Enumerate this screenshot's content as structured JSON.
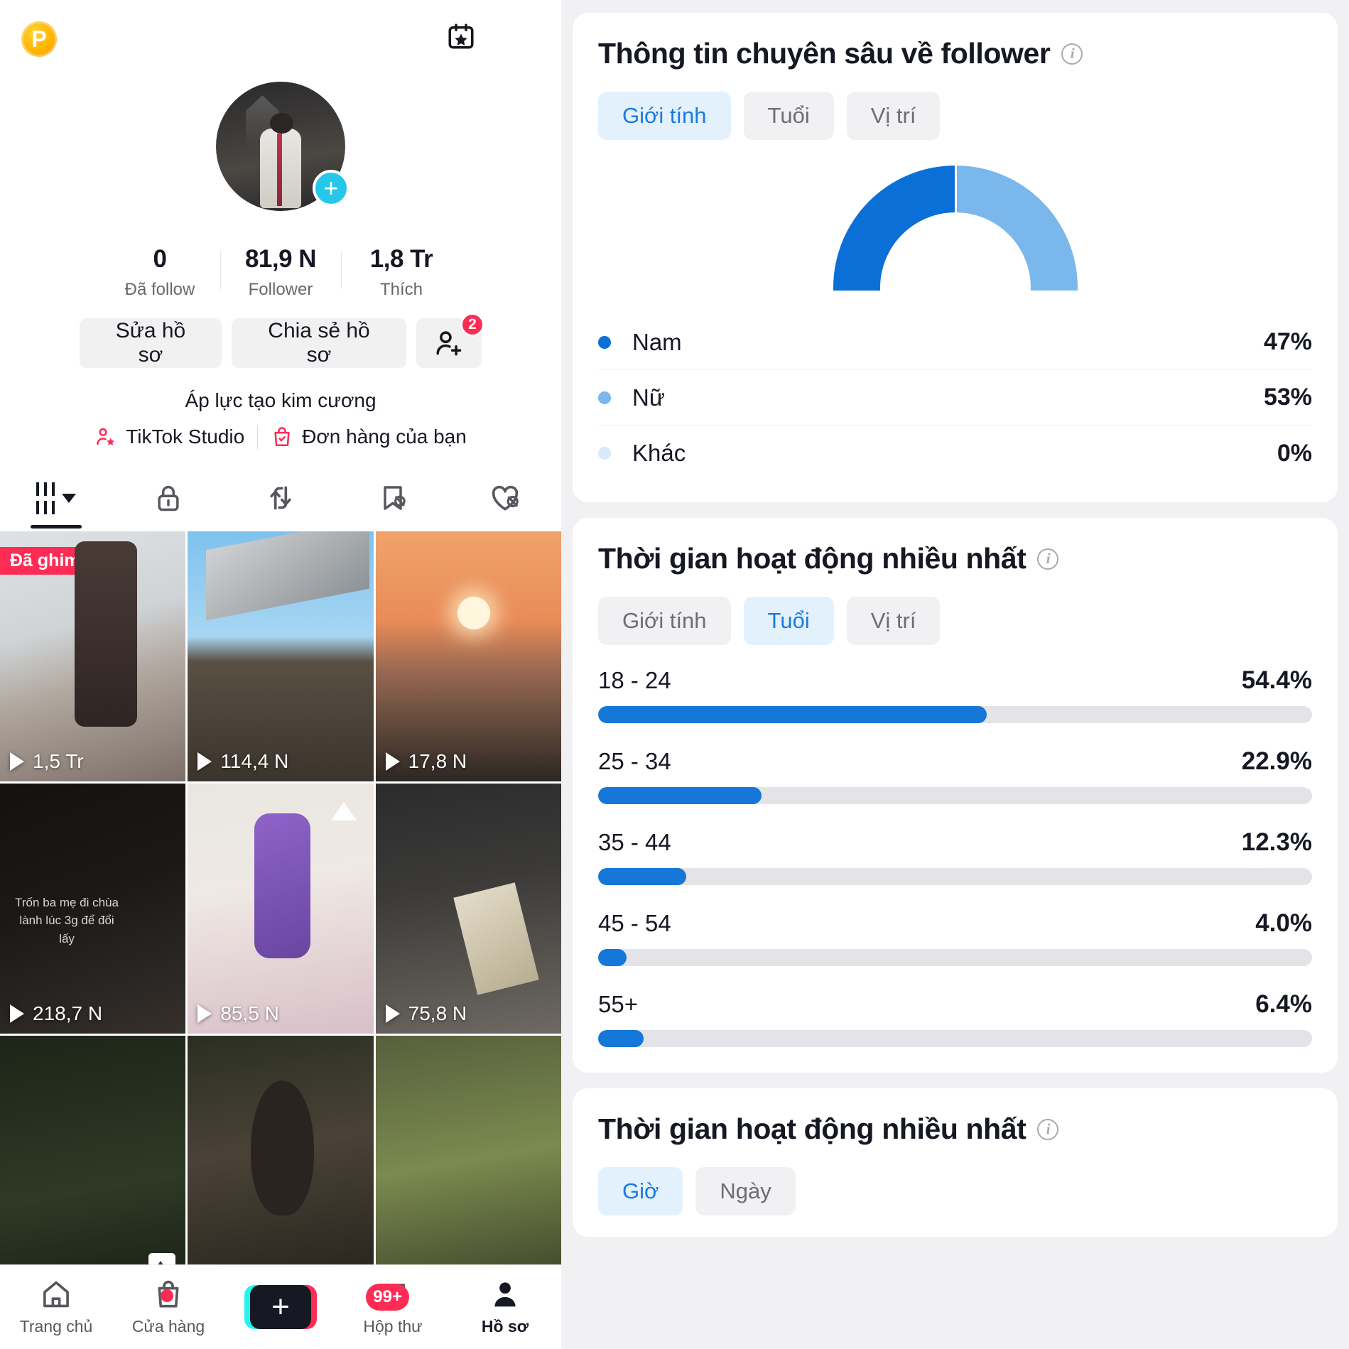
{
  "phone": {
    "topbar": {
      "coin_icon": "p-coin-icon",
      "coin_letter": "P",
      "calendar_icon": "calendar-star-icon",
      "menu_icon": "hamburger-menu-icon"
    },
    "profile": {
      "avatar_icon": "profile-avatar",
      "add_icon": "add-friend-plus-icon",
      "stats": [
        {
          "value": "0",
          "label": "Đã follow"
        },
        {
          "value": "81,9 N",
          "label": "Follower"
        },
        {
          "value": "1,8 Tr",
          "label": "Thích"
        }
      ],
      "edit_label": "Sửa hồ sơ",
      "share_label": "Chia sẻ hồ sơ",
      "add_friend_icon": "add-person-icon",
      "add_friend_badge": "2",
      "bio": "Áp lực tạo kim cương",
      "links": [
        {
          "label": "TikTok Studio",
          "icon": "studio-person-star-icon"
        },
        {
          "label": "Đơn hàng của bạn",
          "icon": "orders-bag-check-icon"
        }
      ]
    },
    "content_tabs": [
      {
        "name": "grid-posts-tab",
        "icon": "grid-bars-icon",
        "active": true
      },
      {
        "name": "private-tab",
        "icon": "lock-icon",
        "active": false
      },
      {
        "name": "repost-tab",
        "icon": "repost-arrows-icon",
        "active": false
      },
      {
        "name": "saved-tab",
        "icon": "bookmark-hidden-icon",
        "active": false
      },
      {
        "name": "liked-tab",
        "icon": "heart-hidden-icon",
        "active": false
      }
    ],
    "videos": [
      {
        "views": "1,5 Tr",
        "pinned_label": "Đã ghim"
      },
      {
        "views": "114,4 N",
        "pinned_label": ""
      },
      {
        "views": "17,8 N",
        "pinned_label": ""
      },
      {
        "views": "218,7 N",
        "pinned_label": "",
        "caption": "Trốn ba mẹ đi chùa lành lúc 3g để đổi lấy"
      },
      {
        "views": "85,5 N",
        "pinned_label": ""
      },
      {
        "views": "75,8 N",
        "pinned_label": ""
      },
      {
        "views": "",
        "pinned_label": ""
      },
      {
        "views": "",
        "pinned_label": ""
      },
      {
        "views": "",
        "pinned_label": ""
      }
    ],
    "bottom_nav": [
      {
        "label": "Trang chủ",
        "icon": "home-icon",
        "badge": "",
        "active": false
      },
      {
        "label": "Cửa hàng",
        "icon": "shop-bag-icon",
        "badge": "dot",
        "active": false
      },
      {
        "label": "",
        "icon": "create-plus-icon",
        "badge": "",
        "active": false
      },
      {
        "label": "Hộp thư",
        "icon": "inbox-message-icon",
        "badge": "99+",
        "active": false
      },
      {
        "label": "Hồ sơ",
        "icon": "profile-person-icon",
        "badge": "",
        "active": true
      }
    ]
  },
  "analytics": {
    "follower_card": {
      "title": "Thông tin chuyên sâu về follower",
      "info_icon": "info-icon",
      "tabs": [
        {
          "label": "Giới tính",
          "active": true
        },
        {
          "label": "Tuổi",
          "active": false
        },
        {
          "label": "Vị trí",
          "active": false
        }
      ]
    },
    "activity_age_card": {
      "title": "Thời gian hoạt động nhiều nhất",
      "info_icon": "info-icon",
      "tabs": [
        {
          "label": "Giới tính",
          "active": false
        },
        {
          "label": "Tuổi",
          "active": true
        },
        {
          "label": "Vị trí",
          "active": false
        }
      ]
    },
    "activity_time_card": {
      "title": "Thời gian hoạt động nhiều nhất",
      "info_icon": "info-icon",
      "tabs": [
        {
          "label": "Giờ",
          "active": true
        },
        {
          "label": "Ngày",
          "active": false
        }
      ]
    },
    "colors": {
      "accent_blue": "#1a7ae0",
      "gauge_dark": "#0a6fd6",
      "gauge_light": "#79b7ec",
      "gauge_other": "#d8eaf9",
      "bar_fill": "#1577d8",
      "bar_track": "#e4e3e7",
      "tiktok_red": "#fe2c55"
    }
  },
  "chart_data": [
    {
      "type": "pie",
      "title": "Thông tin chuyên sâu về follower — Giới tính",
      "labels": [
        "Nam",
        "Nữ",
        "Khác"
      ],
      "values": [
        47,
        53,
        0
      ],
      "value_labels": [
        "47%",
        "53%",
        "0%"
      ],
      "colors": [
        "#0a6fd6",
        "#79b7ec",
        "#d8eaf9"
      ],
      "legend": "bottom",
      "note": "Semi-circular donut gauge, left half dark blue (Nam), right half light blue (Nữ)"
    },
    {
      "type": "bar",
      "title": "Thời gian hoạt động nhiều nhất — Tuổi",
      "orientation": "horizontal",
      "categories": [
        "18 - 24",
        "25 - 34",
        "35 - 44",
        "45 - 54",
        "55+"
      ],
      "values": [
        54.4,
        22.9,
        12.3,
        4.0,
        6.4
      ],
      "value_labels": [
        "54.4%",
        "22.9%",
        "12.3%",
        "4.0%",
        "6.4%"
      ],
      "xlabel": "",
      "ylabel": "",
      "xlim": [
        0,
        100
      ],
      "grid": false,
      "color": "#1577d8",
      "track_color": "#e4e3e7"
    }
  ]
}
